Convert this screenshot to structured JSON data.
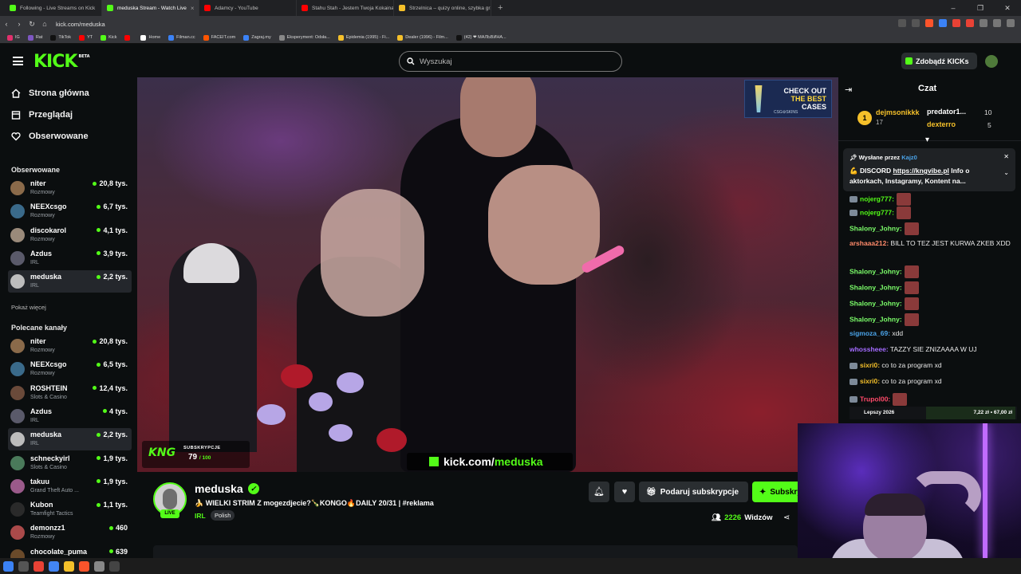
{
  "browser": {
    "tabs": [
      {
        "label": "Following - Live Streams on Kick",
        "color": "#53fc18",
        "active": false
      },
      {
        "label": "meduska Stream - Watch Live",
        "color": "#53fc18",
        "active": true
      },
      {
        "label": "Adamcy - YouTube",
        "color": "#ff0000",
        "active": false
      },
      {
        "label": "Stahu Stah - Jestem Twoja Kokaina",
        "color": "#ff0000",
        "active": false
      },
      {
        "label": "Strzelnica – quizy online, szybka gra",
        "color": "#f5c02a",
        "active": false
      }
    ],
    "new_tab": "+",
    "url": "kick.com/meduska",
    "bookmarks": [
      {
        "label": "IG",
        "color": "#e1306c"
      },
      {
        "label": "Rat",
        "color": "#7e57c2"
      },
      {
        "label": "TikTok",
        "color": "#111111"
      },
      {
        "label": "YT",
        "color": "#ff0000"
      },
      {
        "label": "Kick",
        "color": "#53fc18"
      },
      {
        "label": "",
        "color": "#ff0000"
      },
      {
        "label": "Home",
        "color": "#ffffff"
      },
      {
        "label": "Filman.cc",
        "color": "#3b82f6"
      },
      {
        "label": "FACEIT.com",
        "color": "#ff5500"
      },
      {
        "label": "Zagraj.my",
        "color": "#3b82f6"
      },
      {
        "label": "Eksperyment: Odsła...",
        "color": "#888888"
      },
      {
        "label": "Epidemia (1995) - Fi...",
        "color": "#f5c02a"
      },
      {
        "label": "Dealer (1996) - Film...",
        "color": "#f5c02a"
      },
      {
        "label": "(42) ❤ МАЛЬВИНА...",
        "color": "#111111"
      }
    ]
  },
  "header": {
    "logo": "KICK",
    "logo_badge": "BETA",
    "search_placeholder": "Wyszukaj",
    "kicks_button": "Zdobądź KICKs"
  },
  "sidebar": {
    "nav": [
      {
        "label": "Strona główna",
        "icon": "home-icon"
      },
      {
        "label": "Przeglądaj",
        "icon": "browse-icon"
      },
      {
        "label": "Obserwowane",
        "icon": "heart-icon"
      }
    ],
    "following_title": "Obserwowane",
    "following": [
      {
        "name": "niter",
        "category": "Rozmowy",
        "viewers": "20,8 tys.",
        "avatar": "#8a6a4a"
      },
      {
        "name": "NEEXcsgo",
        "category": "Rozmowy",
        "viewers": "6,7 tys.",
        "avatar": "#3a6a8a"
      },
      {
        "name": "discokarol",
        "category": "Rozmowy",
        "viewers": "4,1 tys.",
        "avatar": "#9a8a7a"
      },
      {
        "name": "Azdus",
        "category": "IRL",
        "viewers": "3,9 tys.",
        "avatar": "#5a5a6a"
      },
      {
        "name": "meduska",
        "category": "IRL",
        "viewers": "2,2 tys.",
        "avatar": "#bdbdbd",
        "selected": true
      }
    ],
    "show_more": "Pokaż więcej",
    "recommended_title": "Polecane kanały",
    "recommended": [
      {
        "name": "niter",
        "category": "Rozmowy",
        "viewers": "20,8 tys.",
        "avatar": "#8a6a4a"
      },
      {
        "name": "NEEXcsgo",
        "category": "Rozmowy",
        "viewers": "6,5 tys.",
        "avatar": "#3a6a8a"
      },
      {
        "name": "ROSHTEIN",
        "category": "Slots & Casino",
        "viewers": "12,4 tys.",
        "avatar": "#6a4a3a"
      },
      {
        "name": "Azdus",
        "category": "IRL",
        "viewers": "4 tys.",
        "avatar": "#5a5a6a"
      },
      {
        "name": "meduska",
        "category": "IRL",
        "viewers": "2,2 tys.",
        "avatar": "#bdbdbd",
        "selected": true
      },
      {
        "name": "schneckyirl",
        "category": "Slots & Casino",
        "viewers": "1,9 tys.",
        "avatar": "#4a7a5a"
      },
      {
        "name": "takuu",
        "category": "Grand Theft Auto ...",
        "viewers": "1,9 tys.",
        "avatar": "#9a5a8a"
      },
      {
        "name": "Kubon",
        "category": "Teamfight Tactics",
        "viewers": "1,1 tys.",
        "avatar": "#2a2a2a"
      },
      {
        "name": "demonzz1",
        "category": "Rozmowy",
        "viewers": "460",
        "avatar": "#aa4a4a"
      },
      {
        "name": "chocolate_puma",
        "category": "",
        "viewers": "639",
        "avatar": "#6a4a2a"
      }
    ]
  },
  "player": {
    "ad_lines": [
      "CHECK OUT",
      "THE BEST",
      "CASES"
    ],
    "ad_brand": "CSG⚙SKINS",
    "sub_logo": "KNG",
    "sub_label": "SUBSKRYPCJE",
    "sub_count": "79",
    "sub_total": "/ 100",
    "url_overlay": "kick.com/",
    "url_overlay_name": "meduska"
  },
  "stream": {
    "name": "meduska",
    "live": "LIVE",
    "title": "🍌 WIELKI STRIM Z mogezdjecie?🍾KONGO🔥DAILY 20/31 | #reklama",
    "category": "IRL",
    "tag": "Polish",
    "gift_label": "Podaruj subskrypcje",
    "subscribe_label": "Subskrybuj",
    "viewers": "2226",
    "viewers_label": "Widzów"
  },
  "chat": {
    "title": "Czat",
    "leaderboard": [
      {
        "rank": "1",
        "name": "dejmsonikkk",
        "value": "17"
      },
      {
        "name": "predator1...",
        "value": "10"
      },
      {
        "name": "dexterro",
        "value": "5"
      }
    ],
    "pinned_by": "Wysłane przez",
    "pinned_user": "Kajz0",
    "pinned_prefix": "💪 DISCORD ",
    "pinned_link": "https://kngvibe.pl",
    "pinned_text": " Info o aktorkach, Instagramy, Kontent na...",
    "messages": [
      {
        "user": "nojerg777:",
        "text": "",
        "color": "#53fc18",
        "emote": true,
        "badge": true
      },
      {
        "user": "nojerg777:",
        "text": "",
        "color": "#53fc18",
        "emote": true,
        "badge": true
      },
      {
        "user": "Shalony_Johny:",
        "text": "",
        "color": "#7cff6a",
        "emote": true,
        "badge": false
      },
      {
        "user": "arshaaa212:",
        "text": "BILL TO TEZ JEST KURWA ZKEB XDD",
        "color": "#ff8a6a",
        "emote": false,
        "badge": false
      },
      {
        "user": "Shalony_Johny:",
        "text": "",
        "color": "#7cff6a",
        "emote": true,
        "badge": false
      },
      {
        "user": "Shalony_Johny:",
        "text": "",
        "color": "#7cff6a",
        "emote": true,
        "badge": false
      },
      {
        "user": "Shalony_Johny:",
        "text": "",
        "color": "#7cff6a",
        "emote": true,
        "badge": false
      },
      {
        "user": "Shalony_Johny:",
        "text": "",
        "color": "#7cff6a",
        "emote": true,
        "badge": false
      },
      {
        "user": "sigmoza_69:",
        "text": "xdd",
        "color": "#4aa3e8",
        "emote": false,
        "badge": false
      },
      {
        "user": "whossheee:",
        "text": "TAZZY SIE ZNIZAAAA W UJ",
        "color": "#a36bff",
        "emote": false,
        "badge": false
      },
      {
        "user": "sixri0:",
        "text": "co to za program xd",
        "color": "#f5c02a",
        "emote": false,
        "badge": true
      },
      {
        "user": "sixri0:",
        "text": "co to za program xd",
        "color": "#f5c02a",
        "emote": false,
        "badge": true
      },
      {
        "user": "Trupol00:",
        "text": "",
        "color": "#ff4a6a",
        "emote": true,
        "badge": true
      }
    ],
    "prediction_label": "Lepszy 2026",
    "prediction_odds": "7,22 zł • 67,00 zł"
  },
  "taskbar": {
    "icons": [
      {
        "name": "windows-start-icon",
        "color": "#3b82f6"
      },
      {
        "name": "search-icon",
        "color": "#555555"
      },
      {
        "name": "chrome-icon",
        "color": "#e94235"
      },
      {
        "name": "chrome-icon",
        "color": "#4285f4"
      },
      {
        "name": "app-icon",
        "color": "#f5c02a"
      },
      {
        "name": "brave-icon",
        "color": "#fb542b"
      },
      {
        "name": "settings-icon",
        "color": "#888888"
      },
      {
        "name": "terminal-icon",
        "color": "#444444"
      }
    ]
  }
}
